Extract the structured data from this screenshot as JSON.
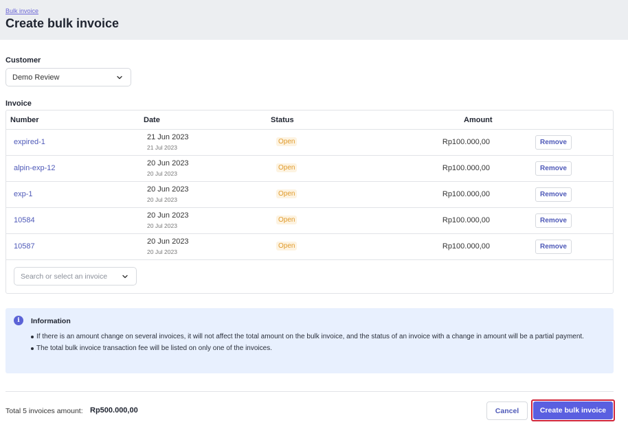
{
  "header": {
    "breadcrumb": "Bulk invoice",
    "title": "Create bulk invoice"
  },
  "customer": {
    "label": "Customer",
    "selected": "Demo Review",
    "icon": "chevron-down-icon"
  },
  "invoice": {
    "label": "Invoice",
    "columns": [
      "Number",
      "Date",
      "Status",
      "Amount"
    ],
    "rows": [
      {
        "number": "expired-1",
        "date": "21 Jun 2023",
        "due": "21 Jul 2023",
        "status": "Open",
        "amount": "Rp100.000,00",
        "action": "Remove"
      },
      {
        "number": "alpin-exp-12",
        "date": "20 Jun 2023",
        "due": "20 Jul 2023",
        "status": "Open",
        "amount": "Rp100.000,00",
        "action": "Remove"
      },
      {
        "number": "exp-1",
        "date": "20 Jun 2023",
        "due": "20 Jul 2023",
        "status": "Open",
        "amount": "Rp100.000,00",
        "action": "Remove"
      },
      {
        "number": "10584",
        "date": "20 Jun 2023",
        "due": "20 Jul 2023",
        "status": "Open",
        "amount": "Rp100.000,00",
        "action": "Remove"
      },
      {
        "number": "10587",
        "date": "20 Jun 2023",
        "due": "20 Jul 2023",
        "status": "Open",
        "amount": "Rp100.000,00",
        "action": "Remove"
      }
    ],
    "search_placeholder": "Search or select an invoice"
  },
  "info": {
    "icon_glyph": "i",
    "title": "Information",
    "items": [
      "If there is an amount change on several invoices, it will not affect the total amount on the bulk invoice, and the status of an invoice with a change in amount will be a partial payment.",
      "The total bulk invoice transaction fee will be listed on only one of the invoices."
    ]
  },
  "footer": {
    "total_label": "Total 5 invoices amount:",
    "total_value": "Rp500.000,00",
    "cancel_label": "Cancel",
    "create_label": "Create bulk invoice"
  },
  "colors": {
    "accent": "#5a5fe0",
    "link": "#4e59b8",
    "status_open": "#e09b2d",
    "info_bg": "#e8f0fe",
    "highlight_outline": "#d0243a"
  }
}
